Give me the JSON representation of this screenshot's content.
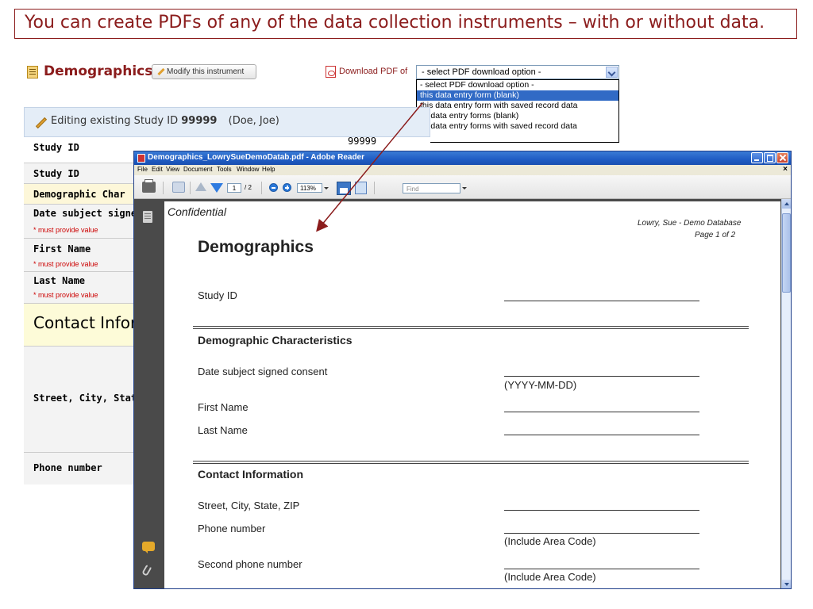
{
  "banner": {
    "text": "You can create PDFs of any of the data collection instruments – with or without data."
  },
  "instrument": {
    "title": "Demographics",
    "modify_button": "Modify this instrument",
    "download_label": "Download PDF of",
    "select_value": "- select PDF download option -",
    "dropdown_options": [
      "- select PDF download option -",
      "this data entry form (blank)",
      "this data entry form with saved record data",
      "all data entry forms (blank)",
      "all data entry forms with saved record data"
    ],
    "selected_option_index": 1
  },
  "edit_bar": {
    "prefix": "Editing existing Study ID",
    "study_id": "99999",
    "name": "(Doe, Joe)"
  },
  "form_rows": {
    "row1_label": "Study ID",
    "row1_value": "99999",
    "row2_label": "Study ID",
    "row3_label": "Demographic Char",
    "row4_label": "Date subject signe",
    "row4_req": "* must provide value",
    "row5_label": "First Name",
    "row5_req": "* must provide value",
    "row6_label": "Last Name",
    "row6_req": "* must provide value",
    "row7_label": "Contact Infor",
    "row8_label": "Street, City, State,",
    "row9_label": "Phone number"
  },
  "reader": {
    "title": "Demographics_LowrySueDemoDatab.pdf - Adobe Reader",
    "menu": [
      "File",
      "Edit",
      "View",
      "Document",
      "Tools",
      "Window",
      "Help"
    ],
    "menu_close": "×",
    "page_current": "1",
    "page_count": "/ 2",
    "zoom": "113%",
    "find_placeholder": "Find"
  },
  "pdf": {
    "confidential": "Confidential",
    "header_db": "Lowry, Sue - Demo Database",
    "header_page": "Page 1 of 2",
    "title": "Demographics",
    "study_id": "Study ID",
    "section1": "Demographic Characteristics",
    "date_consent": "Date subject signed consent",
    "date_hint": "(YYYY-MM-DD)",
    "first_name": "First Name",
    "last_name": "Last Name",
    "section2": "Contact Information",
    "street": "Street, City, State, ZIP",
    "phone": "Phone number",
    "phone_hint": "(Include Area Code)",
    "phone2": "Second phone number",
    "phone2_hint": "(Include Area Code)"
  },
  "colors": {
    "banner": "#8b1c1c",
    "highlight": "#316ac5",
    "arrow": "#8b1c1c"
  }
}
